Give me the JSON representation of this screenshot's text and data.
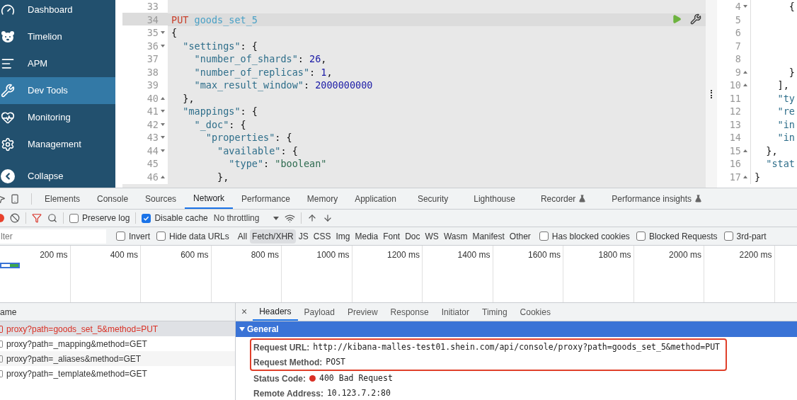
{
  "sidebar": {
    "items": [
      {
        "label": "Dashboard",
        "selected": false
      },
      {
        "label": "Timelion",
        "selected": false
      },
      {
        "label": "APM",
        "selected": false
      },
      {
        "label": "Dev Tools",
        "selected": true
      },
      {
        "label": "Monitoring",
        "selected": false
      },
      {
        "label": "Management",
        "selected": false
      }
    ],
    "collapse": {
      "label": "Collapse"
    }
  },
  "editor": {
    "lines": [
      {
        "number": "33",
        "selected": false
      },
      {
        "number": "34",
        "selected": true,
        "tokens": [
          {
            "kind": "method",
            "text": "PUT"
          },
          {
            "kind": "url",
            "text": " goods_set_5"
          }
        ]
      },
      {
        "number": "35",
        "expanded": true,
        "selected": false,
        "tokens": [
          {
            "kind": "punct",
            "text": "{"
          }
        ]
      },
      {
        "number": "36",
        "expanded": true,
        "selected": false,
        "tokens": [
          {
            "kind": "key",
            "text": "  \"settings\""
          },
          {
            "kind": "punct",
            "text": ": {"
          }
        ]
      },
      {
        "number": "37",
        "selected": false,
        "tokens": [
          {
            "kind": "key",
            "text": "    \"number_of_shards\""
          },
          {
            "kind": "punct",
            "text": ": "
          },
          {
            "kind": "number",
            "text": "26"
          },
          {
            "kind": "punct",
            "text": ","
          }
        ]
      },
      {
        "number": "38",
        "selected": false,
        "tokens": [
          {
            "kind": "key",
            "text": "    \"number_of_replicas\""
          },
          {
            "kind": "punct",
            "text": ": "
          },
          {
            "kind": "number",
            "text": "1"
          },
          {
            "kind": "punct",
            "text": ","
          }
        ]
      },
      {
        "number": "39",
        "selected": false,
        "tokens": [
          {
            "kind": "key",
            "text": "    \"max_result_window\""
          },
          {
            "kind": "punct",
            "text": ": "
          },
          {
            "kind": "number",
            "text": "2000000000"
          }
        ]
      },
      {
        "number": "40",
        "expanded": false,
        "selected": false,
        "tokens": [
          {
            "kind": "punct",
            "text": "  },"
          }
        ]
      },
      {
        "number": "41",
        "expanded": true,
        "selected": false,
        "tokens": [
          {
            "kind": "key",
            "text": "  \"mappings\""
          },
          {
            "kind": "punct",
            "text": ": {"
          }
        ]
      },
      {
        "number": "42",
        "expanded": true,
        "selected": false,
        "tokens": [
          {
            "kind": "key",
            "text": "    \"_doc\""
          },
          {
            "kind": "punct",
            "text": ": {"
          }
        ]
      },
      {
        "number": "43",
        "expanded": true,
        "selected": false,
        "tokens": [
          {
            "kind": "key",
            "text": "      \"properties\""
          },
          {
            "kind": "punct",
            "text": ": {"
          }
        ]
      },
      {
        "number": "44",
        "expanded": true,
        "selected": false,
        "tokens": [
          {
            "kind": "key",
            "text": "        \"available\""
          },
          {
            "kind": "punct",
            "text": ": {"
          }
        ]
      },
      {
        "number": "45",
        "selected": false,
        "tokens": [
          {
            "kind": "key",
            "text": "          \"type\""
          },
          {
            "kind": "punct",
            "text": ": "
          },
          {
            "kind": "string",
            "text": "\"boolean\""
          }
        ]
      },
      {
        "number": "46",
        "expanded": false,
        "selected": false,
        "tokens": [
          {
            "kind": "punct",
            "text": "        },"
          }
        ]
      }
    ]
  },
  "output": {
    "lines": [
      {
        "number": "4",
        "expanded": true,
        "tokens": [
          {
            "kind": "punct",
            "text": "      {"
          }
        ]
      },
      {
        "number": "5"
      },
      {
        "number": "6"
      },
      {
        "number": "7"
      },
      {
        "number": "8"
      },
      {
        "number": "9",
        "expanded": false,
        "tokens": [
          {
            "kind": "punct",
            "text": "      }"
          }
        ]
      },
      {
        "number": "10",
        "expanded": false,
        "tokens": [
          {
            "kind": "punct",
            "text": "    ],"
          }
        ]
      },
      {
        "number": "11",
        "tokens": [
          {
            "kind": "key",
            "text": "    \"ty"
          }
        ]
      },
      {
        "number": "12",
        "tokens": [
          {
            "kind": "key",
            "text": "    \"re"
          }
        ]
      },
      {
        "number": "13",
        "tokens": [
          {
            "kind": "key",
            "text": "    \"in"
          }
        ]
      },
      {
        "number": "14",
        "tokens": [
          {
            "kind": "key",
            "text": "    \"in"
          }
        ]
      },
      {
        "number": "15",
        "expanded": false,
        "tokens": [
          {
            "kind": "punct",
            "text": "  },"
          }
        ]
      },
      {
        "number": "16",
        "tokens": [
          {
            "kind": "key",
            "text": "  \"stat"
          }
        ]
      },
      {
        "number": "17",
        "expanded": false,
        "tokens": [
          {
            "kind": "punct",
            "text": "}"
          }
        ]
      }
    ]
  },
  "devtools": {
    "tabs": [
      {
        "label": "Elements",
        "selected": false,
        "experimental": false
      },
      {
        "label": "Console",
        "selected": false,
        "experimental": false
      },
      {
        "label": "Sources",
        "selected": false,
        "experimental": false
      },
      {
        "label": "Network",
        "selected": true,
        "experimental": false
      },
      {
        "label": "Performance",
        "selected": false,
        "experimental": false
      },
      {
        "label": "Memory",
        "selected": false,
        "experimental": false
      },
      {
        "label": "Application",
        "selected": false,
        "experimental": false
      },
      {
        "label": "Security",
        "selected": false,
        "experimental": false
      },
      {
        "label": "Lighthouse",
        "selected": false,
        "experimental": false
      },
      {
        "label": "Recorder",
        "selected": false,
        "experimental": true
      },
      {
        "label": "Performance insights",
        "selected": false,
        "experimental": true
      }
    ],
    "toolbar": {
      "recording": true,
      "filter_active": true,
      "preserve_log": {
        "label": "Preserve log",
        "checked": false
      },
      "disable_cache": {
        "label": "Disable cache",
        "checked": true
      },
      "throttling": {
        "value": "No throttling"
      }
    },
    "filter": {
      "placeholder": "lter",
      "invert": {
        "label": "Invert",
        "checked": false
      },
      "hide_data_urls": {
        "label": "Hide data URLs",
        "checked": false
      },
      "types": [
        {
          "label": "All",
          "selected": false
        },
        {
          "label": "Fetch/XHR",
          "selected": true
        },
        {
          "label": "JS",
          "selected": false
        },
        {
          "label": "CSS",
          "selected": false
        },
        {
          "label": "Img",
          "selected": false
        },
        {
          "label": "Media",
          "selected": false
        },
        {
          "label": "Font",
          "selected": false
        },
        {
          "label": "Doc",
          "selected": false
        },
        {
          "label": "WS",
          "selected": false
        },
        {
          "label": "Wasm",
          "selected": false
        },
        {
          "label": "Manifest",
          "selected": false
        },
        {
          "label": "Other",
          "selected": false
        }
      ],
      "options": [
        {
          "label": "Has blocked cookies",
          "checked": false
        },
        {
          "label": "Blocked Requests",
          "checked": false
        },
        {
          "label": "3rd-part",
          "checked": false
        }
      ]
    },
    "timeline": {
      "ticks": [
        "200 ms",
        "400 ms",
        "600 ms",
        "800 ms",
        "1000 ms",
        "1200 ms",
        "1400 ms",
        "1600 ms",
        "1800 ms",
        "2000 ms",
        "2200 ms"
      ]
    },
    "requests": {
      "column": "ame",
      "rows": [
        {
          "name": "proxy?path=goods_set_5&method=PUT",
          "selected": true,
          "error": true
        },
        {
          "name": "proxy?path=_mapping&method=GET",
          "selected": false,
          "error": false
        },
        {
          "name": "proxy?path=_aliases&method=GET",
          "selected": false,
          "error": false
        },
        {
          "name": "proxy?path=_template&method=GET",
          "selected": false,
          "error": false
        }
      ]
    },
    "details": {
      "close": "×",
      "tabs": [
        {
          "label": "Headers",
          "selected": true
        },
        {
          "label": "Payload",
          "selected": false
        },
        {
          "label": "Preview",
          "selected": false
        },
        {
          "label": "Response",
          "selected": false
        },
        {
          "label": "Initiator",
          "selected": false
        },
        {
          "label": "Timing",
          "selected": false
        },
        {
          "label": "Cookies",
          "selected": false
        }
      ],
      "section": {
        "title": "General",
        "expanded": true,
        "fields": [
          {
            "label": "Request URL:",
            "value": "http://kibana-malles-test01.shein.com/api/console/proxy?path=goods_set_5&method=PUT",
            "highlighted": true,
            "error": false
          },
          {
            "label": "Request Method:",
            "value": "POST",
            "highlighted": true,
            "error": false
          },
          {
            "label": "Status Code:",
            "value": "400 Bad Request",
            "highlighted": false,
            "error": true
          },
          {
            "label": "Remote Address:",
            "value": "10.123.7.2:80",
            "highlighted": false,
            "error": false
          }
        ]
      }
    }
  }
}
